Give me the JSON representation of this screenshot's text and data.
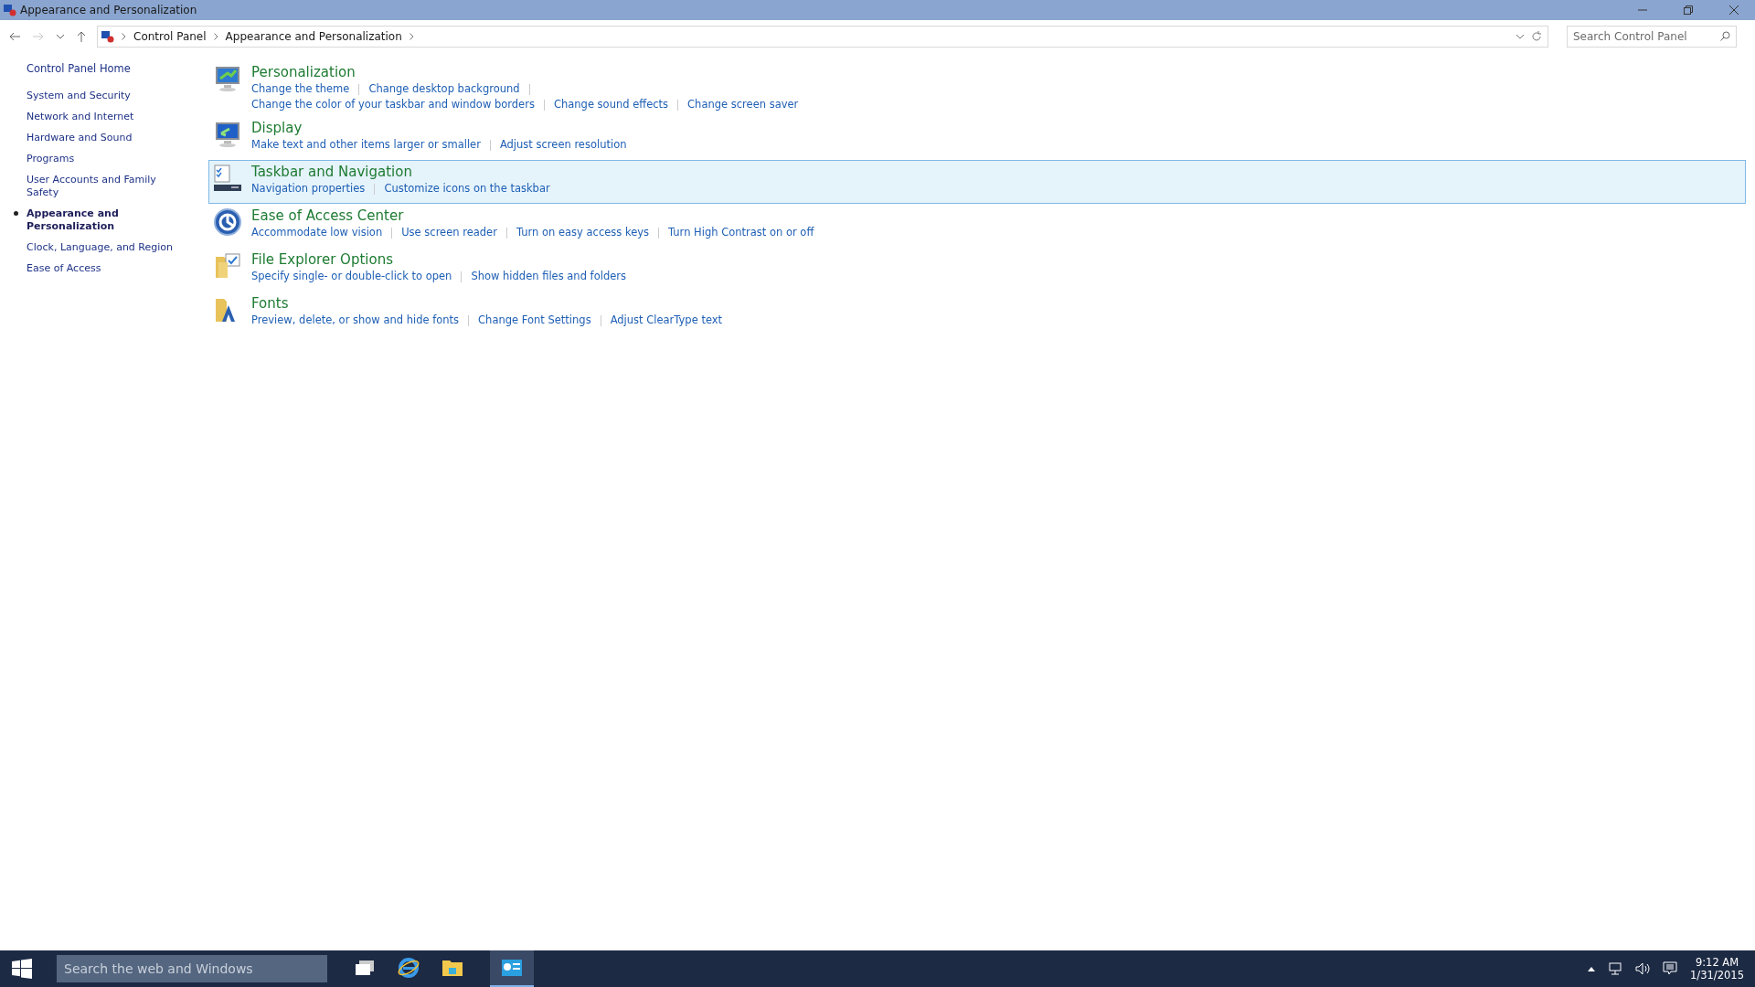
{
  "window": {
    "title": "Appearance and Personalization"
  },
  "breadcrumb": [
    "Control Panel",
    "Appearance and Personalization"
  ],
  "search": {
    "placeholder": "Search Control Panel"
  },
  "sidebar": {
    "home": "Control Panel Home",
    "items": [
      {
        "label": "System and Security",
        "selected": false
      },
      {
        "label": "Network and Internet",
        "selected": false
      },
      {
        "label": "Hardware and Sound",
        "selected": false
      },
      {
        "label": "Programs",
        "selected": false
      },
      {
        "label": "User Accounts and Family Safety",
        "selected": false
      },
      {
        "label": "Appearance and Personalization",
        "selected": true
      },
      {
        "label": "Clock, Language, and Region",
        "selected": false
      },
      {
        "label": "Ease of Access",
        "selected": false
      }
    ]
  },
  "categories": [
    {
      "kind": "personalization",
      "title": "Personalization",
      "hovered": false,
      "link_rows": [
        [
          "Change the theme",
          "Change desktop background"
        ],
        [
          "Change the color of your taskbar and window borders",
          "Change sound effects",
          "Change screen saver"
        ]
      ]
    },
    {
      "kind": "display",
      "title": "Display",
      "hovered": false,
      "link_rows": [
        [
          "Make text and other items larger or smaller",
          "Adjust screen resolution"
        ]
      ]
    },
    {
      "kind": "taskbar",
      "title": "Taskbar and Navigation",
      "hovered": true,
      "link_rows": [
        [
          "Navigation properties",
          "Customize icons on the taskbar"
        ]
      ]
    },
    {
      "kind": "access",
      "title": "Ease of Access Center",
      "hovered": false,
      "link_rows": [
        [
          "Accommodate low vision",
          "Use screen reader",
          "Turn on easy access keys",
          "Turn High Contrast on or off"
        ]
      ]
    },
    {
      "kind": "explorer",
      "title": "File Explorer Options",
      "hovered": false,
      "link_rows": [
        [
          "Specify single- or double-click to open",
          "Show hidden files and folders"
        ]
      ]
    },
    {
      "kind": "fonts",
      "title": "Fonts",
      "hovered": false,
      "link_rows": [
        [
          "Preview, delete, or show and hide fonts",
          "Change Font Settings",
          "Adjust ClearType text"
        ]
      ]
    }
  ],
  "taskbar": {
    "search_placeholder": "Search the web and Windows",
    "apps": [
      {
        "kind": "taskview",
        "selected": false
      },
      {
        "kind": "browser",
        "selected": false
      },
      {
        "kind": "folder",
        "selected": false
      },
      {
        "kind": "controlpanel",
        "selected": true
      }
    ],
    "clock": {
      "time": "9:12 AM",
      "date": "1/31/2015"
    }
  }
}
